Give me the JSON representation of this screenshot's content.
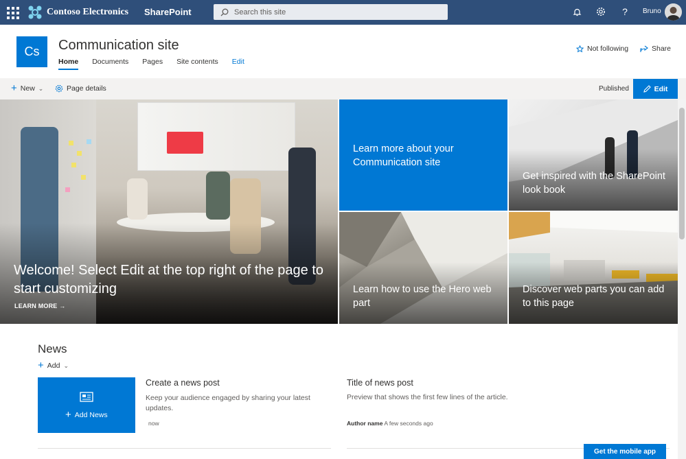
{
  "topbar": {
    "brand": "Contoso Electronics",
    "app": "SharePoint",
    "search_placeholder": "Search this site",
    "user": "Bruno",
    "icons": [
      "app-launcher-icon",
      "bell-icon",
      "gear-icon",
      "help-icon"
    ]
  },
  "header": {
    "logo_text": "Cs",
    "title": "Communication site",
    "nav": [
      "Home",
      "Documents",
      "Pages",
      "Site contents",
      "Edit"
    ],
    "follow": "Not following",
    "share": "Share"
  },
  "commandbar": {
    "new": "New",
    "page_details": "Page details",
    "status": "Published",
    "edit": "Edit"
  },
  "hero": {
    "main": {
      "title": "Welcome! Select Edit at the top right of the page to start customizing",
      "link": "LEARN MORE"
    },
    "tiles": [
      {
        "title": "Learn more about your Communication site"
      },
      {
        "title": "Get inspired with the SharePoint look book"
      },
      {
        "title": "Learn how to use the Hero web part"
      },
      {
        "title": "Discover web parts you can add to this page"
      }
    ]
  },
  "news": {
    "heading": "News",
    "add": "Add",
    "add_news": "Add News",
    "create_post": {
      "title": "Create a news post",
      "desc": "Keep your audience engaged by sharing your latest updates.",
      "time": "now"
    },
    "sample_post": {
      "title": "Title of news post",
      "desc": "Preview that shows the first few lines of the article.",
      "author": "Author name",
      "time": "A few seconds ago"
    }
  },
  "footer": {
    "mobile_app": "Get the mobile app"
  },
  "colors": {
    "suite_bar": "#2f4f7a",
    "accent": "#0078d4"
  }
}
